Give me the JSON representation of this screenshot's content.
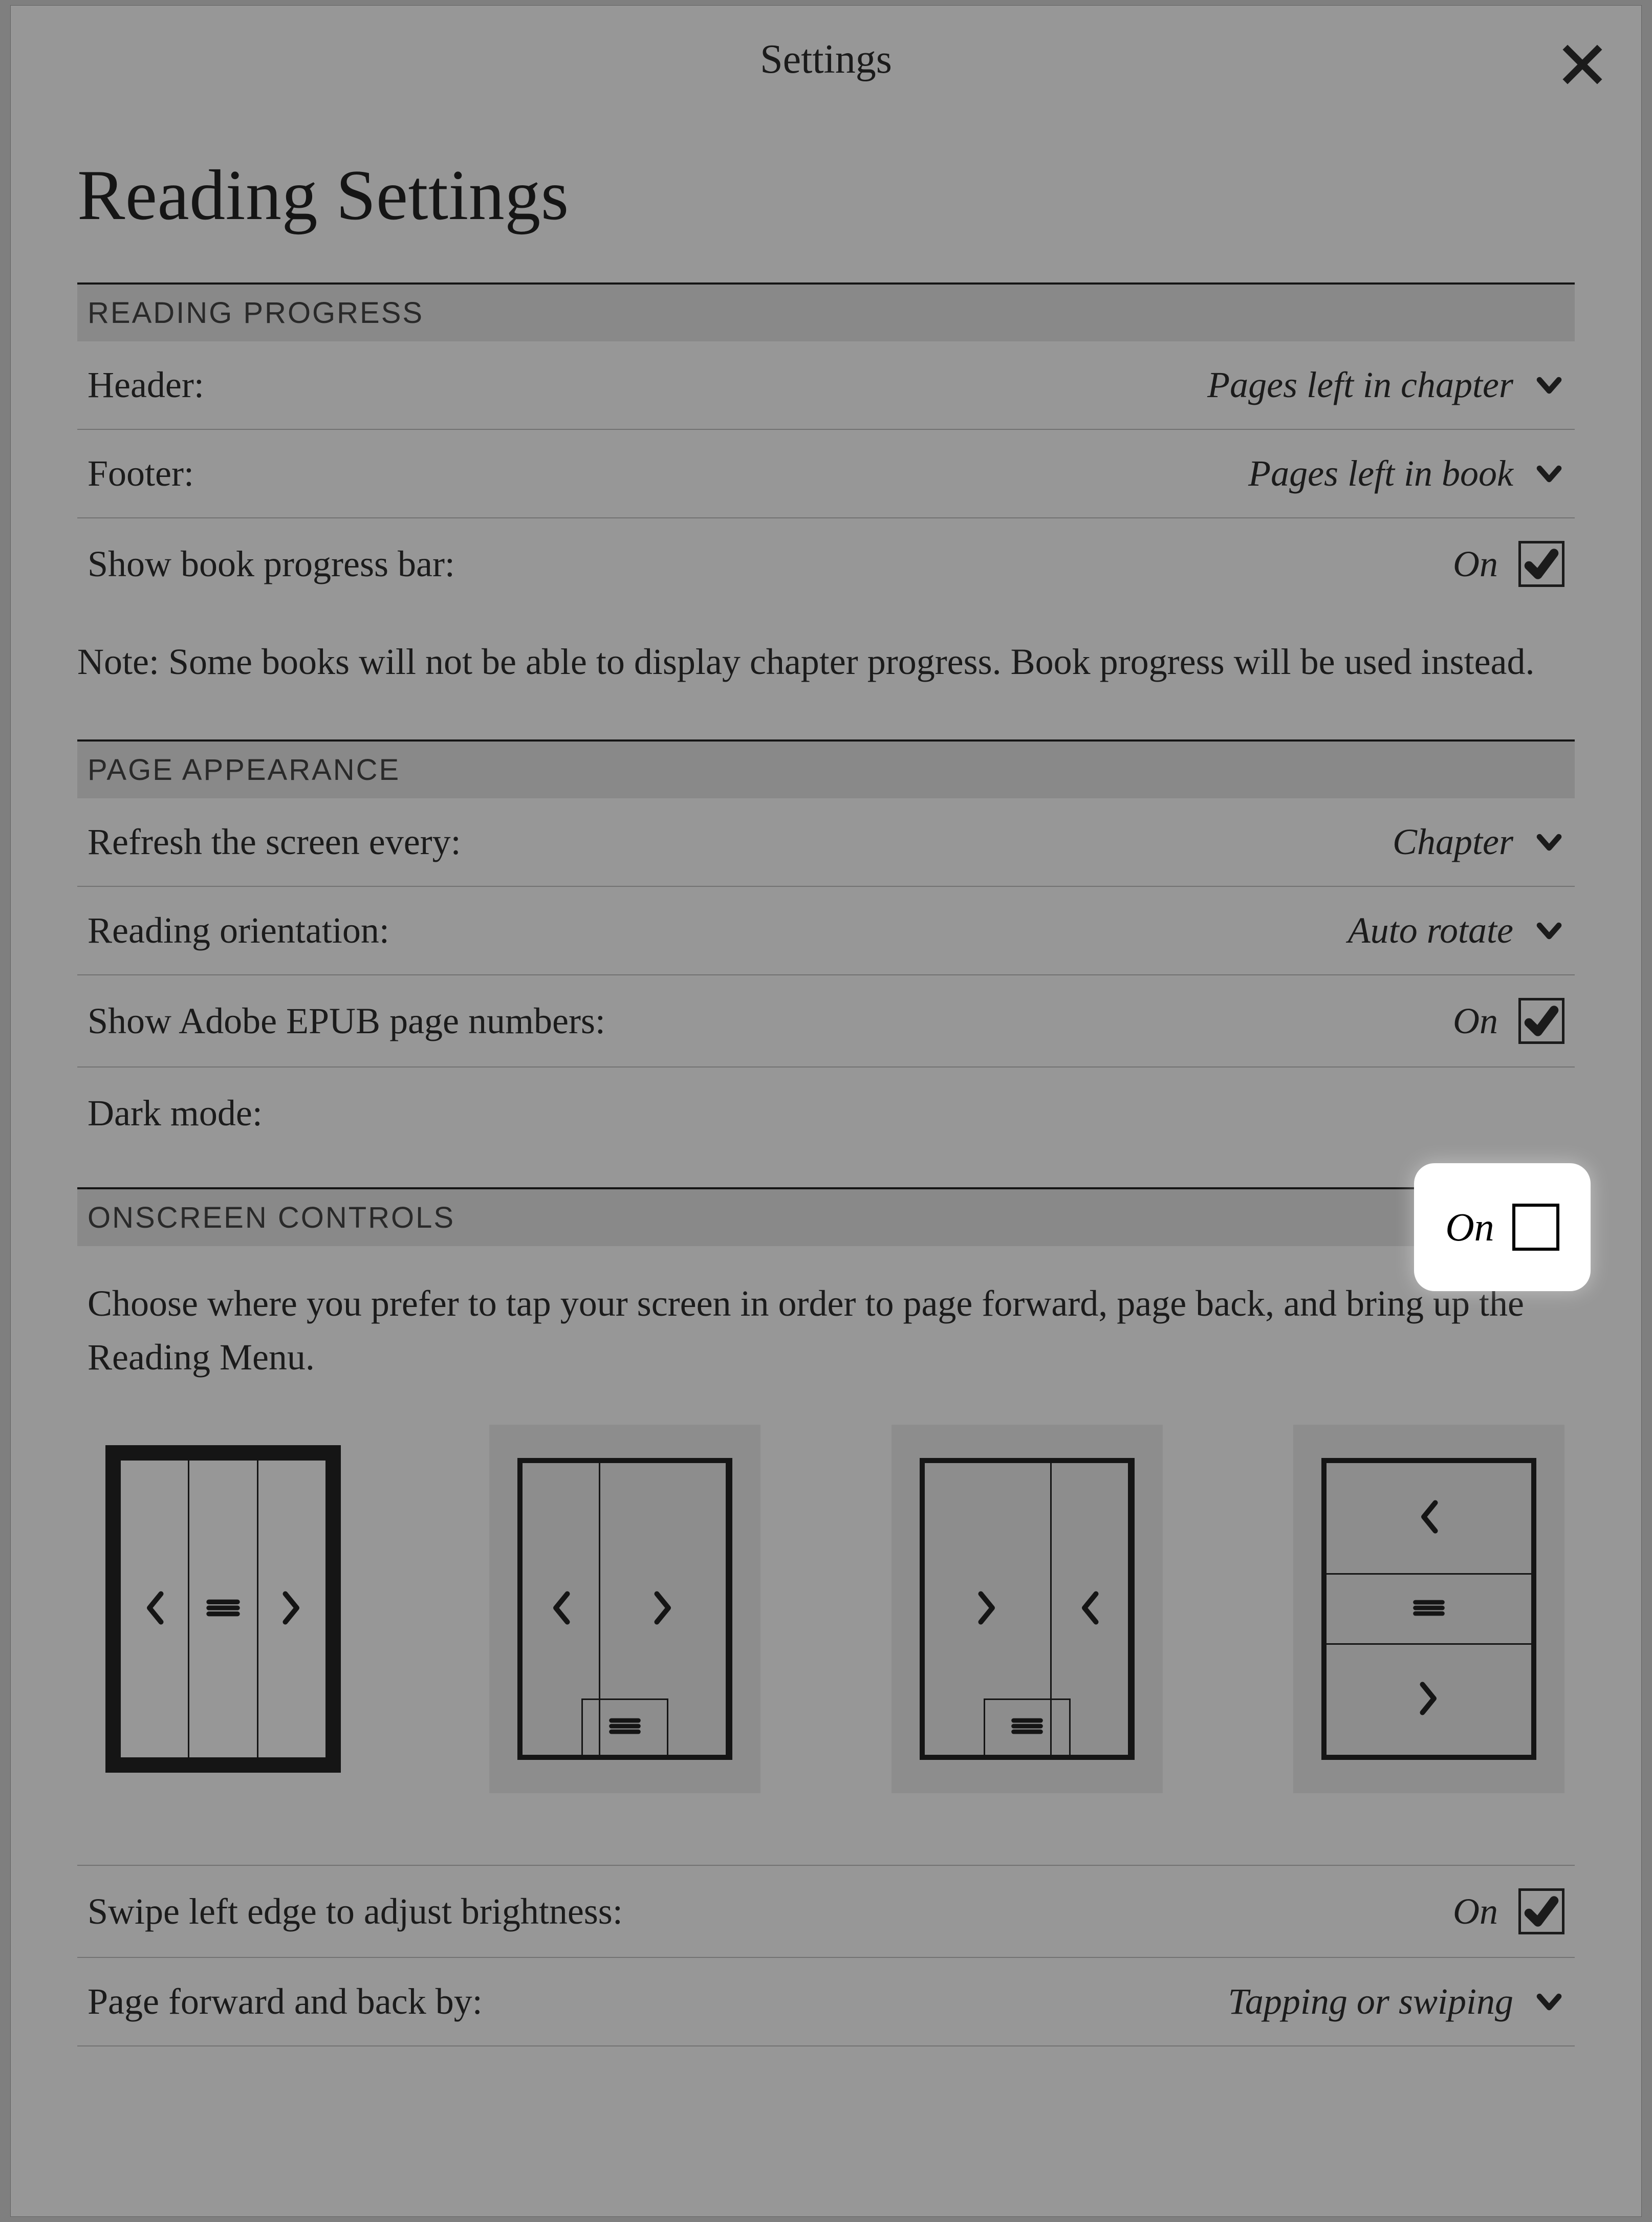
{
  "header": {
    "title": "Settings"
  },
  "page": {
    "title": "Reading Settings"
  },
  "sections": {
    "reading_progress": {
      "title": "READING PROGRESS",
      "header_row": {
        "label": "Header:",
        "value": "Pages left in chapter"
      },
      "footer_row": {
        "label": "Footer:",
        "value": "Pages left in book"
      },
      "progress_bar_row": {
        "label": "Show book progress bar:",
        "value": "On"
      },
      "note": "Note: Some books will not be able to display chapter progress. Book progress will be used instead."
    },
    "page_appearance": {
      "title": "PAGE APPEARANCE",
      "refresh_row": {
        "label": "Refresh the screen every:",
        "value": "Chapter"
      },
      "orientation_row": {
        "label": "Reading orientation:",
        "value": "Auto rotate"
      },
      "adobe_row": {
        "label": "Show Adobe EPUB page numbers:",
        "value": "On"
      },
      "dark_mode_row": {
        "label": "Dark mode:",
        "value": "On"
      }
    },
    "onscreen_controls": {
      "title": "ONSCREEN CONTROLS",
      "instruction": "Choose where you prefer to tap your screen in order to page forward, page back, and bring up the Reading Menu.",
      "swipe_row": {
        "label": "Swipe left edge to adjust brightness:",
        "value": "On"
      },
      "page_nav_row": {
        "label": "Page forward and back by:",
        "value": "Tapping or swiping"
      }
    }
  }
}
